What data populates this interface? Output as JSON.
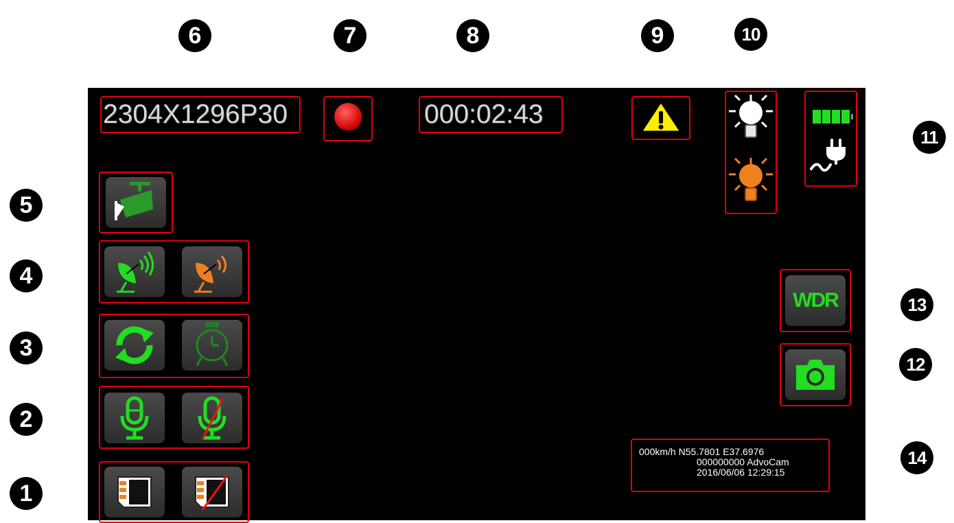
{
  "callouts": {
    "c1": "1",
    "c2": "2",
    "c3": "3",
    "c4": "4",
    "c5": "5",
    "c6": "6",
    "c7": "7",
    "c8": "8",
    "c9": "9",
    "c10": "10",
    "c11": "11",
    "c12": "12",
    "c13": "13",
    "c14": "14"
  },
  "status_bar": {
    "resolution": "2304X1296P30",
    "record_icon": "record-dot-icon",
    "timer": "000:02:43",
    "warning_icon": "warning-triangle-icon",
    "light_icons": [
      "daylight-bulb-icon",
      "ir-light-bulb-icon"
    ],
    "power_icons": [
      "battery-full-icon",
      "power-plug-icon"
    ]
  },
  "left_controls": {
    "camera_button": "surveillance-camera-icon",
    "gps_buttons": [
      "gps-dish-on-icon",
      "gps-dish-off-icon"
    ],
    "loop_buttons": [
      "loop-record-icon",
      "alarm-clock-icon"
    ],
    "mic_buttons": [
      "microphone-on-icon",
      "microphone-off-icon"
    ],
    "sd_buttons": [
      "sd-card-icon",
      "sd-card-off-icon"
    ]
  },
  "right_controls": {
    "wdr_label": "WDR",
    "snapshot_icon": "camera-snapshot-icon"
  },
  "info": {
    "line1": "000km/h N55.7801 E37.6976",
    "line2": "000000000 AdvoCam",
    "line3": "2016/06/06 12:29:15"
  },
  "colors": {
    "highlight": "#e0000f",
    "active_green": "#22dd22",
    "inactive_orange": "#f08020",
    "record_red": "#ee0000",
    "warning_yellow": "#ffee00"
  }
}
